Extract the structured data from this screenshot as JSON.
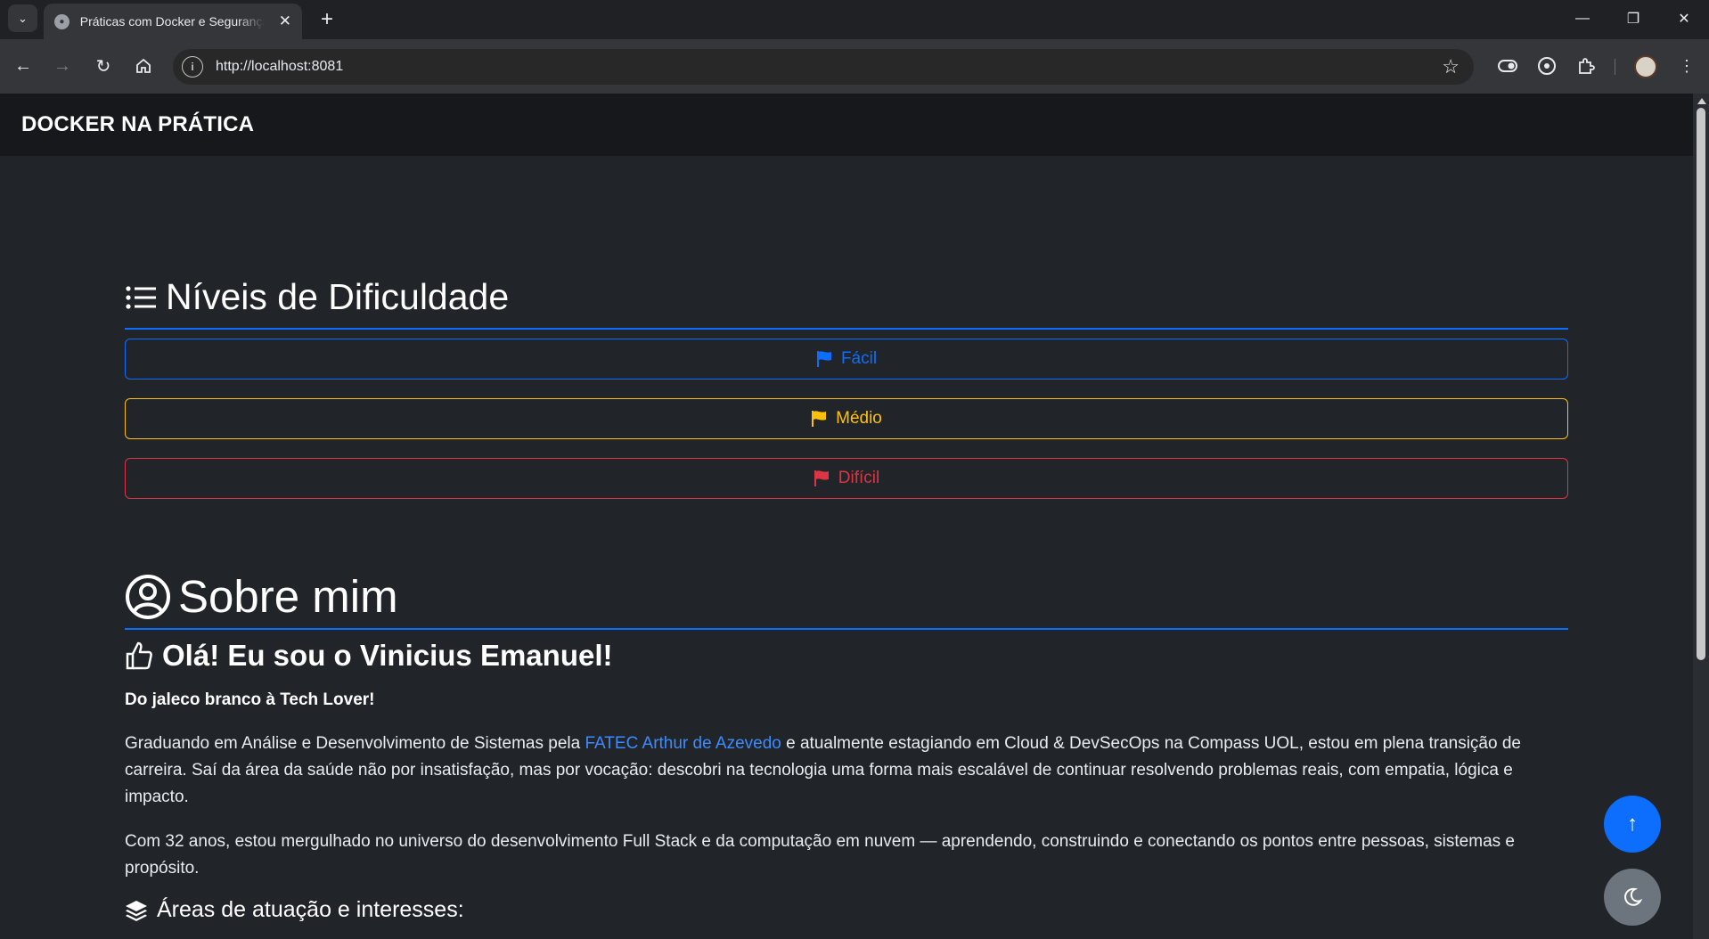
{
  "browser": {
    "tab_title": "Práticas com Docker e Segurança",
    "url": "http://localhost:8081",
    "icons": {
      "tab_menu": "chevron-down-icon",
      "favicon": "globe-icon",
      "tab_close": "close-icon",
      "new_tab": "plus-icon",
      "back": "arrow-left-icon",
      "forward": "arrow-right-icon",
      "reload": "reload-icon",
      "home": "home-icon",
      "site_info": "info-icon",
      "bookmark": "star-icon",
      "extensions": "puzzle-icon",
      "menu": "kebab-menu-icon"
    }
  },
  "navbar": {
    "brand": "DOCKER NA PRÁTICA"
  },
  "levels": {
    "title": "Níveis de Dificuldade",
    "buttons": [
      {
        "label": "Fácil",
        "color": "#0d6efd"
      },
      {
        "label": "Médio",
        "color": "#ffc107"
      },
      {
        "label": "Difícil",
        "color": "#dc3545"
      }
    ]
  },
  "about": {
    "title": "Sobre mim",
    "greeting": "Olá! Eu sou o Vinicius Emanuel!",
    "tagline": "Do jaleco branco à Tech Lover!",
    "p1_before": "Graduando em Análise e Desenvolvimento de Sistemas pela ",
    "p1_link": "FATEC Arthur de Azevedo",
    "p1_after": " e atualmente estagiando em Cloud & DevSecOps na Compass UOL, estou em plena transição de carreira. Saí da área da saúde não por insatisfação, mas por vocação: descobri na tecnologia uma forma mais escalável de continuar resolvendo problemas reais, com empatia, lógica e impacto.",
    "p2": "Com 32 anos, estou mergulhado no universo do desenvolvimento Full Stack e da computação em nuvem — aprendendo, construindo e conectando os pontos entre pessoas, sistemas e propósito.",
    "areas_title": "Áreas de atuação e interesses:"
  },
  "floating": {
    "back_to_top": "arrow-up-icon",
    "theme_toggle": "moon-icon"
  },
  "colors": {
    "primary": "#0d6efd",
    "warning": "#ffc107",
    "danger": "#dc3545",
    "background": "#212529"
  }
}
